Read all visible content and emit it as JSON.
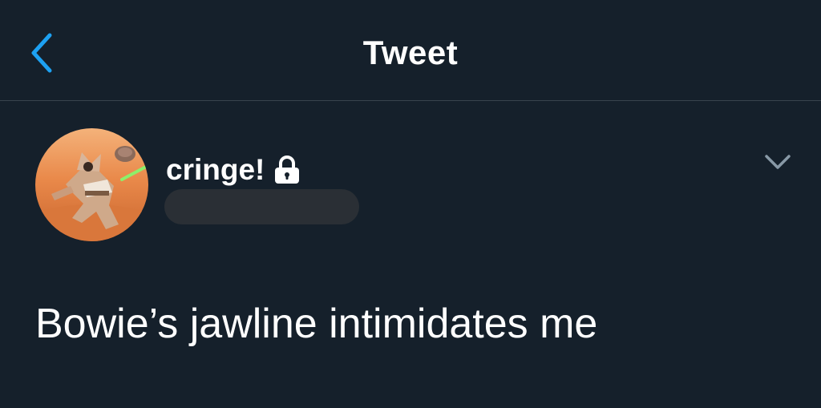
{
  "header": {
    "title": "Tweet",
    "back_icon": "chevron-left-icon"
  },
  "tweet": {
    "display_name": "cringe!",
    "protected_icon": "lock-icon",
    "handle_redacted": true,
    "more_icon": "chevron-down-icon",
    "text": "Bowie’s jawline intimidates me"
  },
  "colors": {
    "background": "#15202b",
    "accent": "#1da1f2",
    "divider": "#38444d",
    "muted": "#8899a6",
    "redaction": "#2a2f35",
    "text": "#ffffff"
  }
}
